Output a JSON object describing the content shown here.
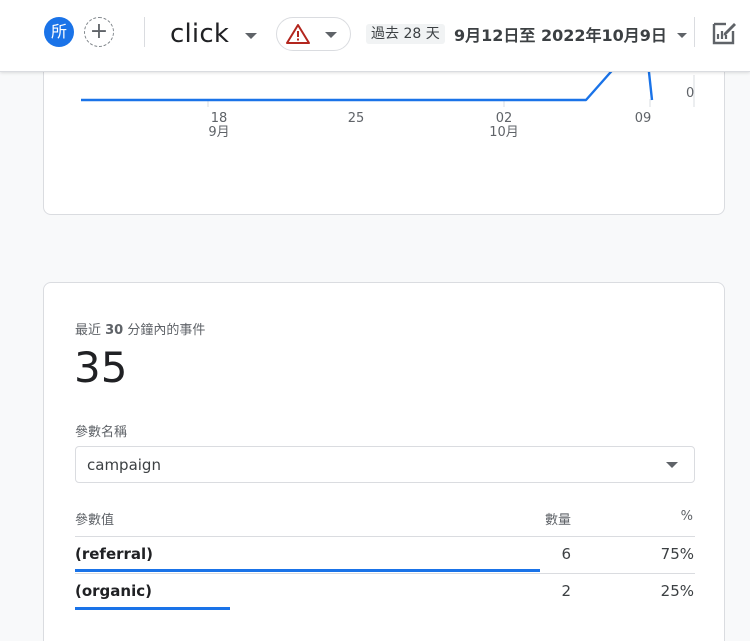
{
  "header": {
    "avatar_label": "所",
    "add_comparison_symbol": "+",
    "event_name": "click",
    "date_chip": "過去 28 天",
    "date_range": "9月12日至 2022年10月9日"
  },
  "chart_data": {
    "type": "line",
    "x_tick_labels": [
      {
        "day": "18",
        "month": "9月"
      },
      {
        "day": "25",
        "month": ""
      },
      {
        "day": "02",
        "month": "10月"
      },
      {
        "day": "09",
        "month": ""
      }
    ],
    "y_tick_labels": [
      "0"
    ],
    "color": "#1a73e8"
  },
  "events": {
    "label_prefix": "最近 ",
    "label_number": "30",
    "label_suffix": " 分鐘內的事件",
    "count": "35",
    "param_label": "參數名稱",
    "param_selected": "campaign",
    "table": {
      "headers": {
        "name": "參數值",
        "count": "數量",
        "pct": "%"
      },
      "rows": [
        {
          "name": "(referral)",
          "count": "6",
          "pct": "75%",
          "share": 0.75
        },
        {
          "name": "(organic)",
          "count": "2",
          "pct": "25%",
          "share": 0.25
        }
      ]
    }
  },
  "colors": {
    "accent": "#1a73e8",
    "warning": "#b3261e"
  }
}
